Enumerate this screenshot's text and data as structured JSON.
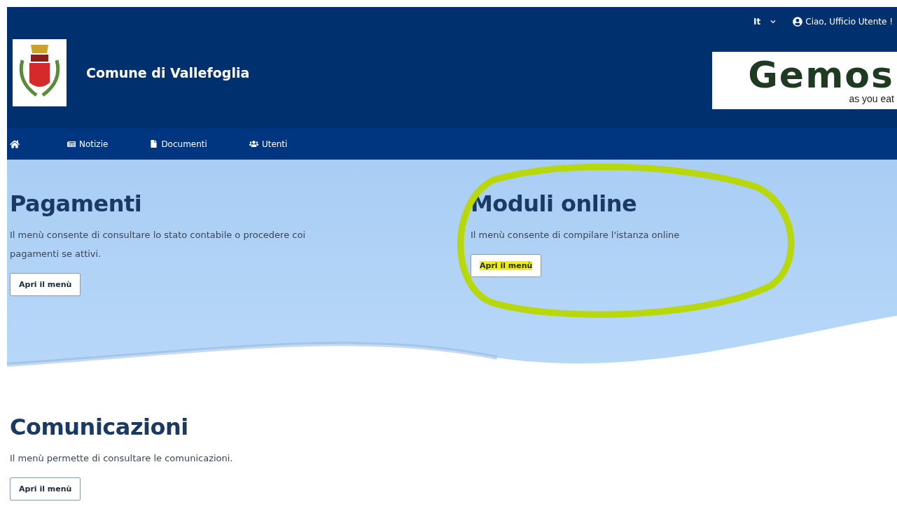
{
  "header": {
    "title": "Comune di Vallefoglia",
    "language": "It",
    "greeting": "Ciao, Ufficio Utente !",
    "partner_logo": {
      "name": "Gemos",
      "tagline": "as you eat"
    }
  },
  "nav": [
    {
      "kind": "home"
    },
    {
      "kind": "news",
      "label": "Notizie"
    },
    {
      "kind": "documents",
      "label": "Documenti"
    },
    {
      "kind": "users",
      "label": "Utenti"
    }
  ],
  "hero_cards": [
    {
      "title": "Pagamenti",
      "description": "Il menù consente di consultare lo stato contabile o procedere coi pagamenti se attivi.",
      "button": "Apri il menù",
      "circled": false,
      "highlighted": false
    },
    {
      "title": "Moduli online",
      "description": "Il menù consente di compilare l'istanza online",
      "button": "Apri il menù",
      "circled": true,
      "highlighted": true
    }
  ],
  "cards": [
    {
      "title": "Comunicazioni",
      "description": "Il menù permette di consultare le comunicazioni.",
      "button": "Apri il menù",
      "circled": false,
      "highlighted": false
    }
  ]
}
